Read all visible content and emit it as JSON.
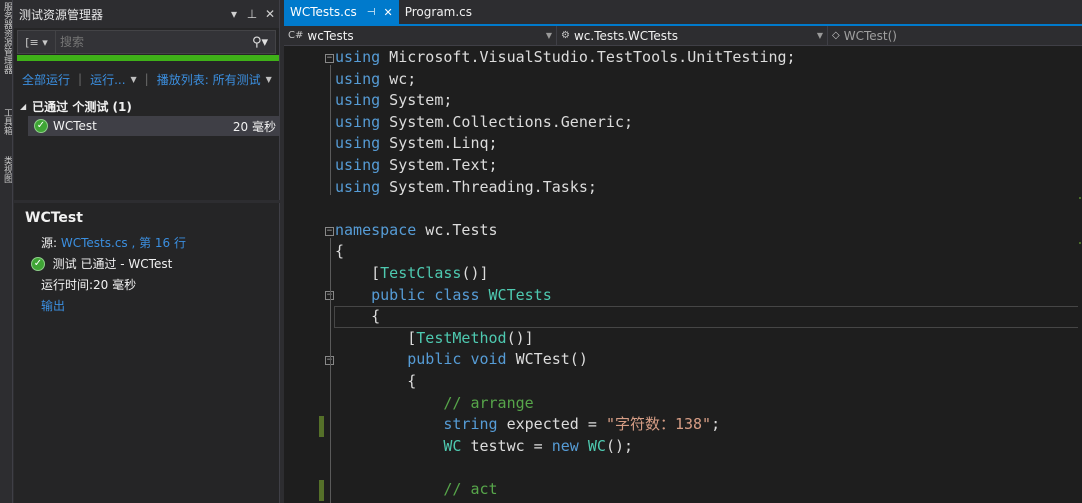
{
  "side_strip": {
    "tabs": [
      "服务器资源管理器",
      "工具箱",
      "类视图"
    ]
  },
  "test_explorer": {
    "title": "测试资源管理器",
    "title_buttons": {
      "dropdown": "▾",
      "pin": "⊥",
      "close": "✕"
    },
    "search": {
      "placeholder": "搜索",
      "group_icon": "group-by-icon",
      "search_icon": "search-icon"
    },
    "progress_color": "#3fb118",
    "toolbar": {
      "run_all": "全部运行",
      "run": "运行...",
      "playlist": "播放列表: 所有测试"
    },
    "group_header": "已通过 个测试 (1)",
    "test_row": {
      "name": "WCTest",
      "duration": "20 毫秒"
    },
    "detail": {
      "title": "WCTest",
      "source_label": "源:",
      "source_link": "WCTests.cs , 第 16 行",
      "status": "测试 已通过 - WCTest",
      "runtime": "运行时间:20 毫秒",
      "output": "输出"
    }
  },
  "editor": {
    "tabs": [
      {
        "label": "WCTests.cs",
        "active": true,
        "pin": "⊣",
        "close": "✕"
      },
      {
        "label": "Program.cs",
        "active": false
      }
    ],
    "nav": {
      "project": "wcTests",
      "type": "wc.Tests.WCTests",
      "member": "WCTest()"
    },
    "lines": [
      [
        [
          "kw",
          "using"
        ],
        [
          "pl",
          " Microsoft.VisualStudio.TestTools.UnitTesting;"
        ]
      ],
      [
        [
          "kw",
          "using"
        ],
        [
          "pl",
          " wc;"
        ]
      ],
      [
        [
          "kw",
          "using"
        ],
        [
          "pl",
          " System;"
        ]
      ],
      [
        [
          "kw",
          "using"
        ],
        [
          "pl",
          " System.Collections.Generic;"
        ]
      ],
      [
        [
          "kw",
          "using"
        ],
        [
          "pl",
          " System.Linq;"
        ]
      ],
      [
        [
          "kw",
          "using"
        ],
        [
          "pl",
          " System.Text;"
        ]
      ],
      [
        [
          "kw",
          "using"
        ],
        [
          "pl",
          " System.Threading.Tasks;"
        ]
      ],
      [],
      [
        [
          "kw",
          "namespace"
        ],
        [
          "pl",
          " wc.Tests"
        ]
      ],
      [
        [
          "pl",
          "{"
        ]
      ],
      [
        [
          "pl",
          "    ["
        ],
        [
          "ty",
          "TestClass"
        ],
        [
          "pl",
          "()]"
        ]
      ],
      [
        [
          "pl",
          "    "
        ],
        [
          "kw",
          "public"
        ],
        [
          "pl",
          " "
        ],
        [
          "kw",
          "class"
        ],
        [
          "pl",
          " "
        ],
        [
          "ty",
          "WCTests"
        ]
      ],
      [
        [
          "pl",
          "    {"
        ]
      ],
      [
        [
          "pl",
          "        ["
        ],
        [
          "ty",
          "TestMethod"
        ],
        [
          "pl",
          "()]"
        ]
      ],
      [
        [
          "pl",
          "        "
        ],
        [
          "kw",
          "public"
        ],
        [
          "pl",
          " "
        ],
        [
          "kw",
          "void"
        ],
        [
          "pl",
          " WCTest()"
        ]
      ],
      [
        [
          "pl",
          "        {"
        ]
      ],
      [
        [
          "pl",
          "            "
        ],
        [
          "cm",
          "// arrange"
        ]
      ],
      [
        [
          "pl",
          "            "
        ],
        [
          "kw",
          "string"
        ],
        [
          "pl",
          " expected = "
        ],
        [
          "st",
          "\"字符数：138\""
        ],
        [
          "pl",
          ";"
        ]
      ],
      [
        [
          "pl",
          "            "
        ],
        [
          "ty",
          "WC"
        ],
        [
          "pl",
          " testwc = "
        ],
        [
          "kw",
          "new"
        ],
        [
          "pl",
          " "
        ],
        [
          "ty",
          "WC"
        ],
        [
          "pl",
          "();"
        ]
      ],
      [],
      [
        [
          "pl",
          "            "
        ],
        [
          "cm",
          "// act"
        ]
      ]
    ]
  }
}
